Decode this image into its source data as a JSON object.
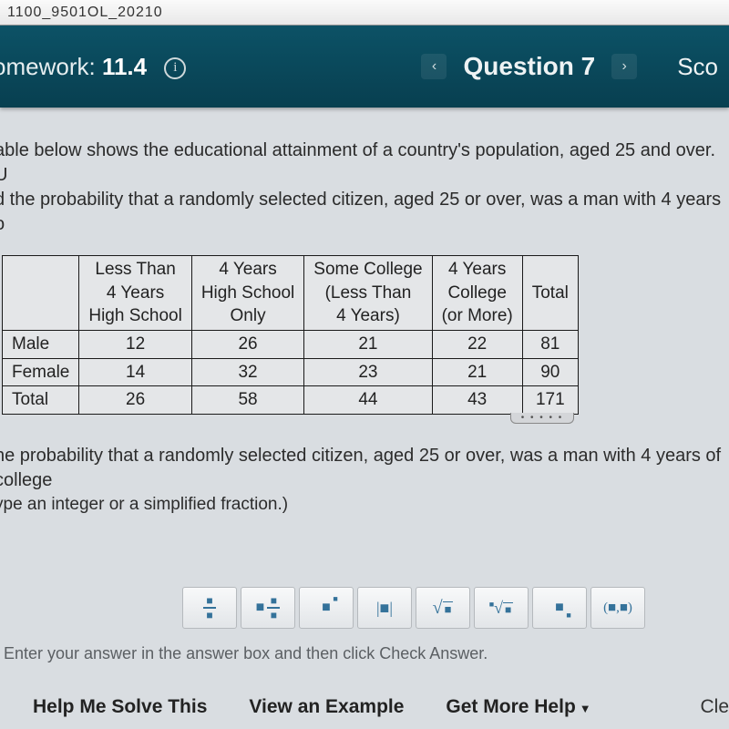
{
  "window": {
    "truncated_top": "1100_9501OL_20210"
  },
  "header": {
    "homework_label": "omework:",
    "homework_num": "11.4",
    "info_icon": "i",
    "question_label": "Question 7",
    "score_label": "Sco"
  },
  "intro": {
    "line1": "able below shows the educational attainment of a country's population, aged 25 and over.  U",
    "line2": "d the probability that a randomly selected citizen, aged 25 or over, was a man with 4 years o"
  },
  "table": {
    "col_headers": [
      "Less Than\n4 Years\nHigh School",
      "4 Years\nHigh School\nOnly",
      "Some College\n(Less Than\n4 Years)",
      "4 Years\nCollege\n(or More)",
      "Total"
    ],
    "rows": [
      {
        "label": "Male",
        "cells": [
          "12",
          "26",
          "21",
          "22",
          "81"
        ]
      },
      {
        "label": "Female",
        "cells": [
          "14",
          "32",
          "23",
          "21",
          "90"
        ]
      },
      {
        "label": "Total",
        "cells": [
          "26",
          "58",
          "44",
          "43",
          "171"
        ]
      }
    ]
  },
  "prompt": {
    "line1": "he probability that a randomly selected citizen, aged 25 or over, was a man with 4 years of college",
    "hint": "ype an integer or a simplified fraction.)"
  },
  "toolbar": {
    "items": [
      "fraction",
      "mixed-fraction",
      "exponent",
      "absolute-value",
      "sqrt",
      "nth-root",
      "subscript",
      "ordered-pair"
    ]
  },
  "enter_hint": "Enter your answer in the answer box and then click Check Answer.",
  "bottom": {
    "help": "Help Me Solve This",
    "example": "View an Example",
    "more": "Get More Help",
    "clear": "Cle"
  }
}
